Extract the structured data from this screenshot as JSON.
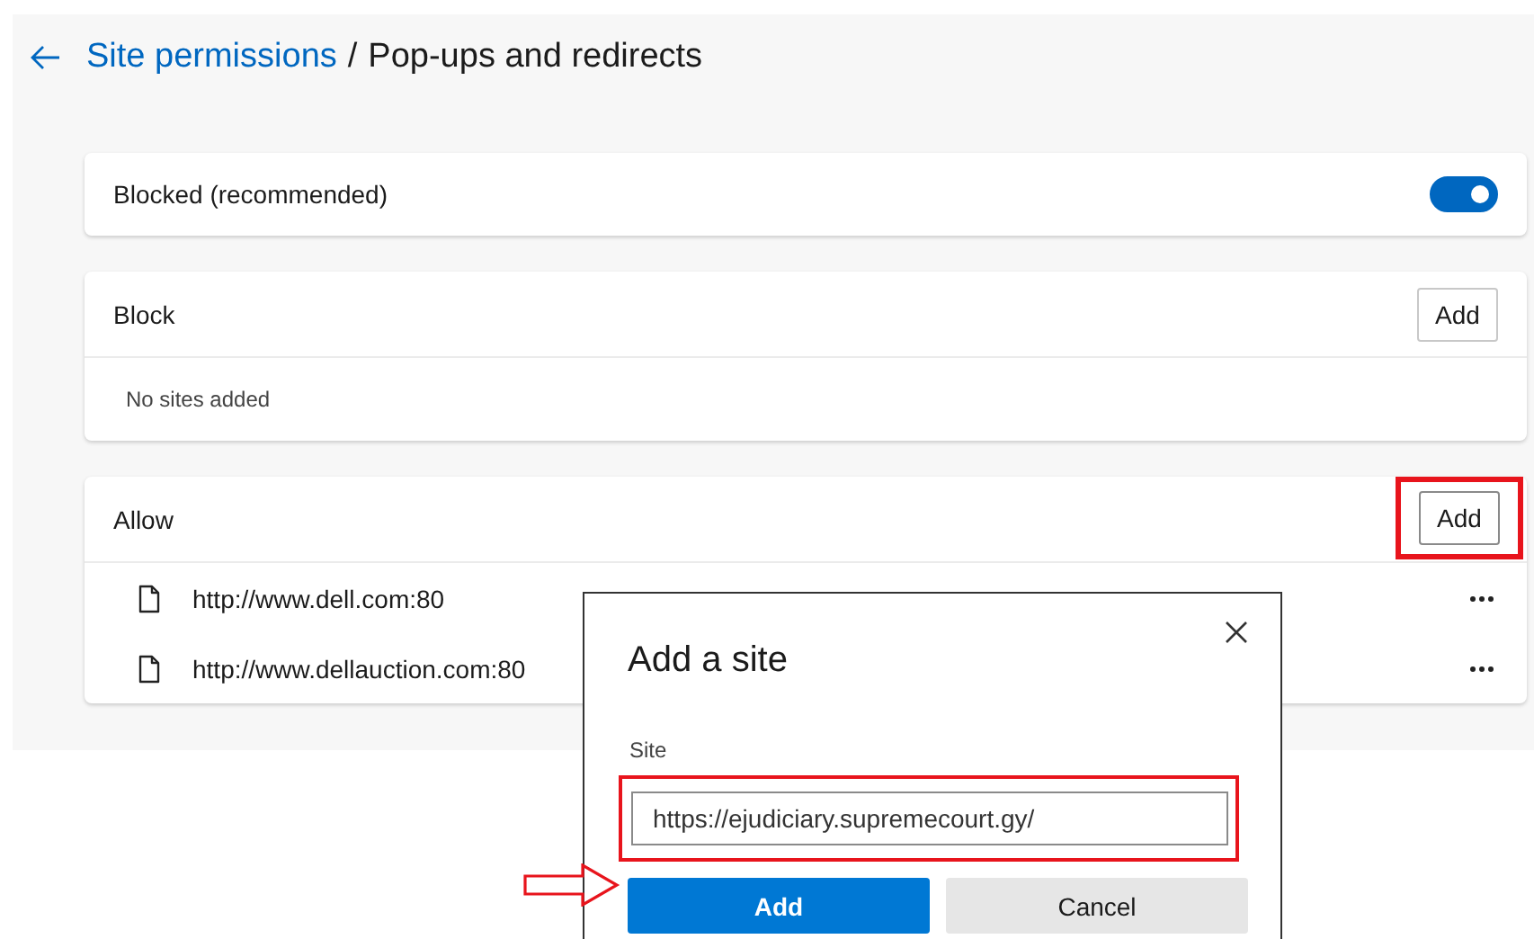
{
  "header": {
    "breadcrumb_link": "Site permissions",
    "separator": "/",
    "title": "Pop-ups and redirects"
  },
  "blocked_setting": {
    "label": "Blocked (recommended)",
    "on": true
  },
  "sections": [
    {
      "title": "Block",
      "add_button": {
        "label": "Add",
        "highlighted": false
      },
      "empty_text": "No sites added"
    },
    {
      "title": "Allow",
      "add_button": {
        "label": "Add",
        "highlighted": true
      },
      "sites": [
        {
          "url": "http://www.dell.com:80"
        },
        {
          "url": "http://www.dellauction.com:80"
        }
      ]
    }
  ],
  "dialog": {
    "title": "Add a site",
    "field_label": "Site",
    "field_value": "https://ejudiciary.supremecourt.gy/",
    "field_highlighted": true,
    "primary_button": {
      "label": "Add",
      "pointed": true
    },
    "cancel_button": {
      "label": "Cancel"
    }
  }
}
